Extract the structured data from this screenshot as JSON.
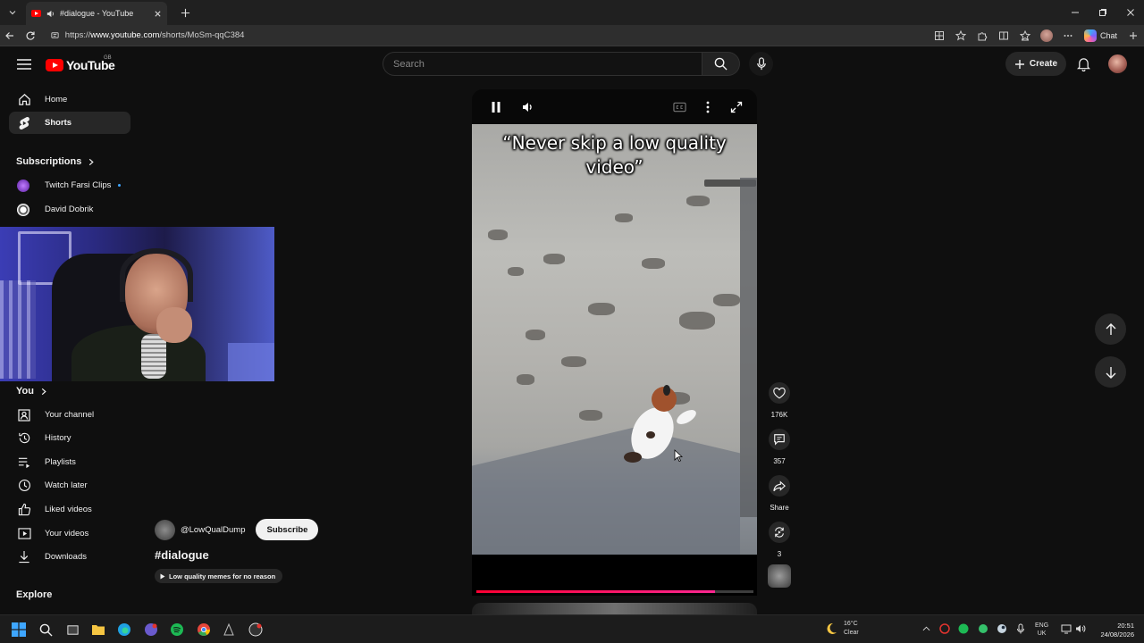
{
  "browser": {
    "tab_title": "#dialogue - YouTube",
    "url_prefix": "https://",
    "url_host": "www.youtube.com",
    "url_path": "/shorts/MoSm-qqC384",
    "chat_label": "Chat"
  },
  "header": {
    "logo_text": "YouTube",
    "country_code": "GB",
    "search_placeholder": "Search",
    "create_label": "Create"
  },
  "sidebar": {
    "home": "Home",
    "shorts": "Shorts",
    "subscriptions_title": "Subscriptions",
    "subscriptions": [
      {
        "name": "Twitch Farsi Clips"
      },
      {
        "name": "David Dobrik"
      }
    ],
    "you_title": "You",
    "you_items": [
      {
        "label": "Your channel",
        "icon": "channel-icon"
      },
      {
        "label": "History",
        "icon": "history-icon"
      },
      {
        "label": "Playlists",
        "icon": "playlists-icon"
      },
      {
        "label": "Watch later",
        "icon": "clock-icon"
      },
      {
        "label": "Liked videos",
        "icon": "thumbs-up-icon"
      },
      {
        "label": "Your videos",
        "icon": "play-icon"
      },
      {
        "label": "Downloads",
        "icon": "download-icon"
      }
    ],
    "explore_title": "Explore"
  },
  "video": {
    "caption": "“Never skip a low quality video”",
    "progress": 0.86
  },
  "actions": {
    "likes": "176K",
    "comments": "357",
    "share": "Share",
    "remix": "3"
  },
  "channel": {
    "handle": "@LowQualDump",
    "subscribe_label": "Subscribe",
    "title": "#dialogue",
    "playlist": "Low quality memes for no reason"
  },
  "taskbar": {
    "temperature": "16°C",
    "weather": "Clear",
    "lang_top": "ENG",
    "lang_bottom": "UK",
    "time": "20:51",
    "date": "24/08/2026"
  },
  "colors": {
    "background": "#0f0f0f",
    "yt_red": "#ff0000",
    "progress": "#ff0033",
    "live_dot": "#3ea6ff"
  }
}
